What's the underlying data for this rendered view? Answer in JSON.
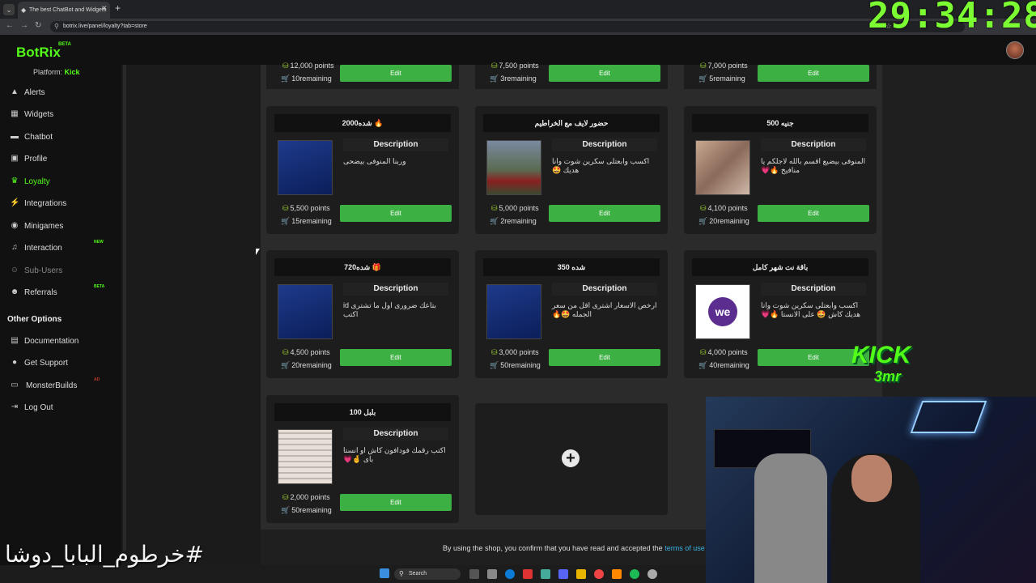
{
  "browser": {
    "tab_title": "The best ChatBot and Widgets",
    "url": "botrix.live/panel/loyalty?tab=store"
  },
  "overlay": {
    "timer": "29:34:28",
    "kick_logo": "KICK",
    "kick_name": "3mr",
    "watermark": "#خرطوم_البابا_دوشا"
  },
  "header": {
    "logo": "BotRix",
    "logo_badge": "BETA"
  },
  "sidebar": {
    "platform_label": "Platform:",
    "platform_value": "Kick",
    "items": [
      {
        "label": "Alerts",
        "icon": "warning-icon"
      },
      {
        "label": "Widgets",
        "icon": "grid-icon"
      },
      {
        "label": "Chatbot",
        "icon": "chat-icon"
      },
      {
        "label": "Profile",
        "icon": "id-card-icon"
      },
      {
        "label": "Loyalty",
        "icon": "trophy-icon"
      },
      {
        "label": "Integrations",
        "icon": "plug-icon"
      },
      {
        "label": "Minigames",
        "icon": "gamepad-icon"
      },
      {
        "label": "Interaction",
        "icon": "music-icon",
        "badge": "NEW"
      },
      {
        "label": "Sub-Users",
        "icon": "users-icon"
      },
      {
        "label": "Referrals",
        "icon": "referral-icon",
        "badge": "BETA"
      }
    ],
    "other_title": "Other Options",
    "other_items": [
      {
        "label": "Documentation",
        "icon": "book-icon"
      },
      {
        "label": "Get Support",
        "icon": "help-icon"
      },
      {
        "label": "MonsterBuilds",
        "icon": "laptop-icon",
        "badge": "AD"
      },
      {
        "label": "Log Out",
        "icon": "logout-icon"
      }
    ]
  },
  "store": {
    "desc_label": "Description",
    "edit_label": "Edit",
    "partial_row": [
      {
        "points": "12,000 points",
        "remaining": "10remaining"
      },
      {
        "points": "7,500 points",
        "remaining": "3remaining"
      },
      {
        "points": "7,000 points",
        "remaining": "5remaining"
      }
    ],
    "items": [
      {
        "title": "2000شده 🔥",
        "desc": "وربنا المنوفى بيضحى",
        "points": "5,500 points",
        "remaining": "15remaining"
      },
      {
        "title": "حضور لايف مع الخراطيم",
        "desc": "اكسب وابعتلى سكرين شوت وانا هديك 🤩",
        "points": "5,000 points",
        "remaining": "2remaining"
      },
      {
        "title": "جنيه 500",
        "desc": "المنوفى بيضيع اقسم بالله لاجلكم يا منافيخ 🔥💗",
        "points": "4,100 points",
        "remaining": "20remaining"
      },
      {
        "title": "720شده 🎁",
        "desc": "بتاعك ضرورى اول ما تشترى id اكتب",
        "points": "4,500 points",
        "remaining": "20remaining"
      },
      {
        "title": "شده 350",
        "desc": "ارخص الاسعار اشترى اقل من سعر الجمله 🤩🔥",
        "points": "3,000 points",
        "remaining": "50remaining"
      },
      {
        "title": "باقة نت شهر كامل",
        "desc": "اكسب وابعتلى سكرين شوت وانا هديك كاش 🤩 على الانستا 🔥💗",
        "points": "4,000 points",
        "remaining": "40remaining"
      },
      {
        "title": "بلبل 100",
        "desc": "اكتب رقمك فودافون كاش او انستا باى 🤞💗",
        "points": "2,000 points",
        "remaining": "50remaining"
      }
    ],
    "terms_text": "By using the shop, you confirm that you have read and accepted the",
    "terms_link": "terms of use",
    "terms_end": "."
  },
  "taskbar": {
    "search_label": "Search"
  }
}
